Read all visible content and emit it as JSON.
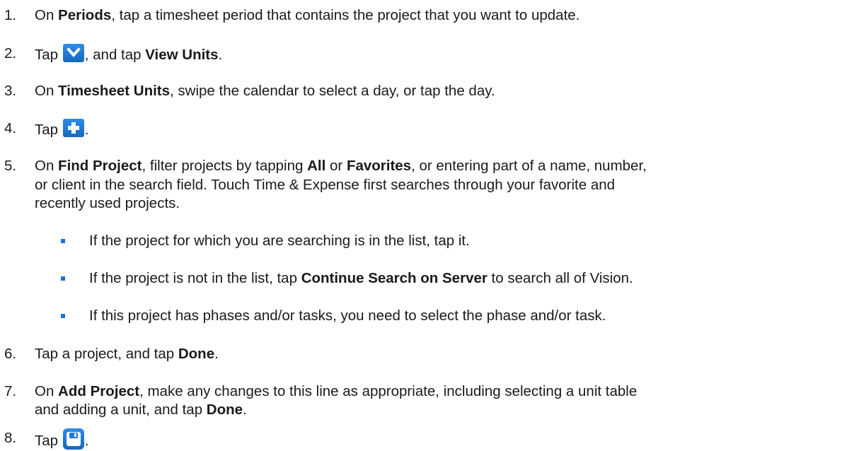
{
  "steps": [
    {
      "num": "1.",
      "parts": [
        "On ",
        "Periods",
        ", tap a timesheet period that contains the project that you want to update."
      ]
    },
    {
      "num": "2.",
      "parts": [
        "Tap ",
        ", and tap ",
        "View Units",
        "."
      ]
    },
    {
      "num": "3.",
      "parts": [
        "On ",
        "Timesheet Units",
        ", swipe the calendar to select a day, or tap the day."
      ]
    },
    {
      "num": "4.",
      "parts": [
        "Tap ",
        "."
      ]
    },
    {
      "num": "5.",
      "parts": [
        "On ",
        "Find Project",
        ", filter projects by tapping ",
        "All",
        " or ",
        "Favorites",
        ", or entering part of a name, number,"
      ],
      "lines": [
        "or client in the search field. Touch Time & Expense first searches through your favorite and",
        "recently used projects."
      ]
    },
    {
      "num": "6.",
      "parts": [
        "Tap a project, and tap ",
        "Done",
        "."
      ]
    },
    {
      "num": "7.",
      "parts": [
        "On ",
        "Add Project",
        ", make any changes to this line as appropriate, including selecting a unit table"
      ],
      "lines": [
        "and adding a unit, and tap ",
        "Done",
        "."
      ]
    },
    {
      "num": "8.",
      "parts": [
        "Tap ",
        "."
      ]
    }
  ],
  "bullets": [
    {
      "parts": [
        "If the project for which you are searching is in the list, tap it."
      ]
    },
    {
      "parts": [
        "If the project is not in the list, tap ",
        "Continue Search on Server",
        " to search all of Vision."
      ]
    },
    {
      "parts": [
        "If this project has phases and/or tasks, you need to select the phase and/or task."
      ]
    }
  ],
  "icons": {
    "expand": "chevron-down-icon",
    "add": "plus-icon",
    "save": "save-icon"
  },
  "colors": {
    "icon_bg": "#1f7ad8",
    "bullet": "#1f6fd0",
    "text": "#1a1a1a"
  }
}
